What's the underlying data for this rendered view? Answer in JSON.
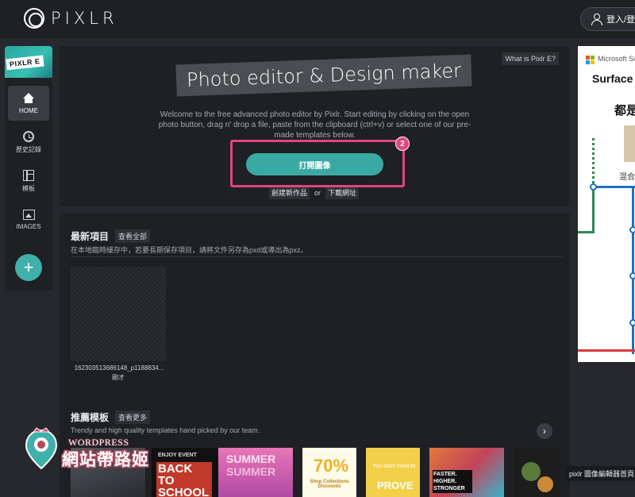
{
  "header": {
    "logo_text": "PIXLR",
    "login_label": "登入/登"
  },
  "sidebar": {
    "brand_tag": "PIXLR E",
    "items": [
      {
        "label": "HOME",
        "icon": "home-icon"
      },
      {
        "label": "歷史記錄",
        "icon": "history-icon"
      },
      {
        "label": "模板",
        "icon": "template-icon"
      },
      {
        "label": "IMAGES",
        "icon": "image-icon"
      }
    ],
    "add_label": "+"
  },
  "hero": {
    "what_label": "What is Pixlr E?",
    "title": "Photo editor & Design maker",
    "description": "Welcome to the free advanced photo editor by Pixlr. Start editing by clicking on the open photo button, drag n' drop a file, paste from the clipboard (ctrl+v) or select one of our pre-made templates below.",
    "open_label": "打開圖像",
    "badge": "2",
    "create_label": "創建新作品",
    "or_label": "or",
    "download_label": "下載網址"
  },
  "recent": {
    "title": "最新項目",
    "view_all": "查看全部",
    "hint": "在本地臨時緩存中，若要長期保存項目，請將文件另存為pxd或導出為pxz。",
    "item_name": "162303513686148_p1188834...",
    "item_time": "剛才"
  },
  "templates": {
    "title": "推薦模板",
    "view_more": "查看更多",
    "description": "Trendy and high quality templates hand picked by our team.",
    "arrow": "›",
    "items": [
      {
        "text": "",
        "bg": "#3b3d44"
      },
      {
        "text": "BACK TO SCHOOL",
        "sub": "ENJOY EVENT",
        "bg": "#111111"
      },
      {
        "text": "SUMMER",
        "bg": "#d96aa8"
      },
      {
        "text": "70%",
        "sub": "Shop Collections Discounts",
        "bg": "#fdfbea"
      },
      {
        "text": "PROVE",
        "sub": "You don't need to",
        "bg": "#f3d04a"
      },
      {
        "text": "FASTER. HIGHER. STRONGER",
        "bg": "#e07a3a"
      },
      {
        "text": "",
        "bg": "#1d1d1d"
      }
    ]
  },
  "ad": {
    "brand": "Microsoft Su",
    "title": "Surface L",
    "subtitle": "都是",
    "mix": "混合"
  },
  "watermark": {
    "brand": "WORDPRESS",
    "title": "網站帶路姬"
  },
  "tooltip": "pixlr 圖像編輯器首頁",
  "colors": {
    "accent": "#3ba9a3",
    "highlight": "#e0467a",
    "panel": "#1e2024",
    "background": "#26282d"
  }
}
